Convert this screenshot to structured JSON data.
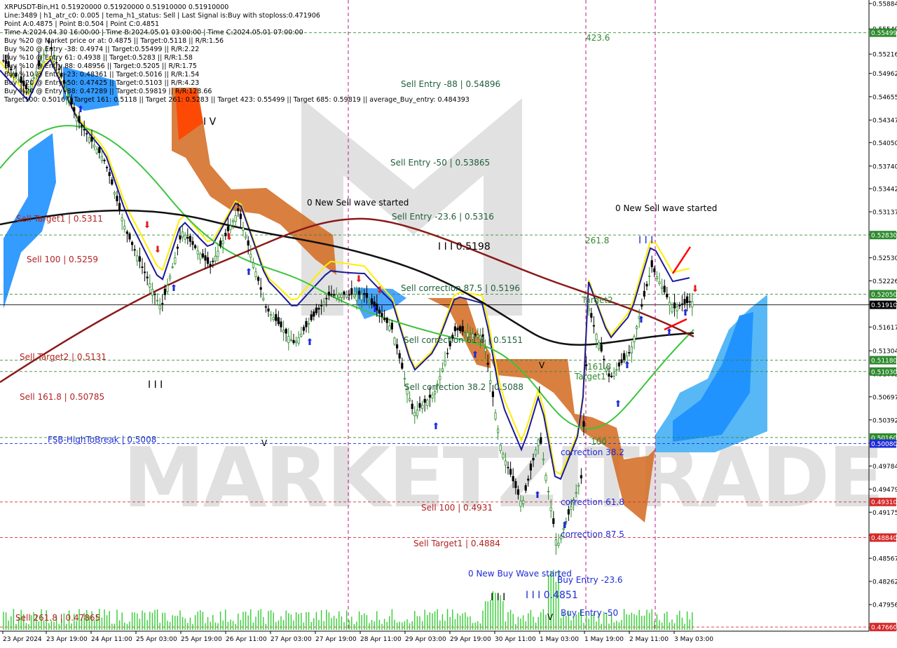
{
  "chart_data": {
    "type": "candlestick",
    "symbol": "XRPUSDT-Bin,H1",
    "ohlc": "0.51920000 0.51920000 0.51910000 0.51910000",
    "current_price": "0.51910",
    "watermark": "MARKETZITRADE",
    "info_lines": [
      "XRPUSDT-Bin,H1  0.51920000 0.51920000 0.51910000 0.51910000",
      "Line:3489  |  h1_atr_c0: 0.005  |  tema_h1_status: Sell  |  Last Signal is:Buy with stoploss:0.471906",
      "Point A:0.4875  |  Point B:0.504  |  Point C:0.4851",
      "Time A:2024.04.30 16:00:00  |  Time B:2024.05.01 03:00:00  |  Time C:2024.05.01 07:00:00",
      "Buy %20 @ Market price or at: 0.4875  ||  Target:0.5118  ||  R/R:1.56",
      "Buy %20 @ Entry -38: 0.4974  ||  Target:0.55499  ||  R/R:2.22",
      "Buy %10 @ Entry 61: 0.4938  ||  Target:0.5283  ||  R/R:1.58",
      "Buy %10 @ Entry 88: 0.48956  ||  Target:0.5205  ||  R/R:1.75",
      "Buy %10 @ Entry -23: 0.48361  ||  Target:0.5016  ||  R/R:1.54",
      "Buy %20 @ Entry -50: 0.47425  ||  Target:0.5103  ||  R/R:4.23",
      "Buy %20 @ Entry -88: 0.47289  ||  Target:0.59819  ||  R/R:128.66",
      "Target100: 0.5016  ||  Target 161: 0.5118  ||  Target 261: 0.5283  ||  Target 423: 0.55499  ||  Target 685: 0.59819  ||  average_Buy_entry: 0.484393"
    ],
    "price_ticks": [
      "0.55884",
      "0.55549",
      "0.55216",
      "0.54962",
      "0.54655",
      "0.54347",
      "0.54050",
      "0.53740",
      "0.53442",
      "0.53137",
      "0.52836",
      "0.52530",
      "0.52226",
      "0.51917",
      "0.51617",
      "0.51304",
      "0.51002",
      "0.50697",
      "0.50392",
      "0.50087",
      "0.49784",
      "0.49479",
      "0.49175",
      "0.48870",
      "0.48567",
      "0.48262",
      "0.47956",
      "0.47652"
    ],
    "time_ticks": [
      "23 Apr 2024",
      "23 Apr 19:00",
      "24 Apr 11:00",
      "25 Apr 03:00",
      "25 Apr 19:00",
      "26 Apr 11:00",
      "27 Apr 03:00",
      "27 Apr 19:00",
      "28 Apr 11:00",
      "29 Apr 03:00",
      "29 Apr 19:00",
      "30 Apr 11:00",
      "1 May 03:00",
      "1 May 19:00",
      "2 May 11:00",
      "3 May 03:00"
    ],
    "price_tags": [
      {
        "value": "0.55499",
        "price": 0.55499,
        "color": "#2e8b2e"
      },
      {
        "value": "0.52830",
        "price": 0.5283,
        "color": "#2e8b2e"
      },
      {
        "value": "0.52050",
        "price": 0.5205,
        "color": "#2e8b2e"
      },
      {
        "value": "0.51910",
        "price": 0.5191,
        "color": "#000000"
      },
      {
        "value": "0.51180",
        "price": 0.5118,
        "color": "#2e8b2e"
      },
      {
        "value": "0.51030",
        "price": 0.5103,
        "color": "#2e8b2e"
      },
      {
        "value": "0.50160",
        "price": 0.5016,
        "color": "#2e8b2e"
      },
      {
        "value": "0.50080",
        "price": 0.5008,
        "color": "#1e2bd6"
      },
      {
        "value": "0.49310",
        "price": 0.4931,
        "color": "#d62a2a"
      },
      {
        "value": "0.48840",
        "price": 0.4884,
        "color": "#d62a2a"
      },
      {
        "value": "0.47660",
        "price": 0.4766,
        "color": "#d62a2a"
      }
    ],
    "labels": [
      {
        "text": "423.6",
        "color": "#2e8b2e"
      },
      {
        "text": "Sell Entry -88 | 0.54896",
        "color": "#1f5e3a"
      },
      {
        "text": "Sell Entry -50 | 0.53865",
        "color": "#1f5e3a"
      },
      {
        "text": "0 New Sell wave started",
        "color": "#000000"
      },
      {
        "text": "Sell Entry -23.6 | 0.5316",
        "color": "#1f5e3a"
      },
      {
        "text": "0 New Sell wave started",
        "color": "#000000"
      },
      {
        "text": "Sell Target1 | 0.5311",
        "color": "#b22222"
      },
      {
        "text": "Sell 100 | 0.5259",
        "color": "#b22222"
      },
      {
        "text": "261.8",
        "color": "#2e8b2e"
      },
      {
        "text": "I I I 0.5198",
        "color": "#000000"
      },
      {
        "text": "Sell correction 87.5 | 0.5196",
        "color": "#1f5e3a"
      },
      {
        "text": "Target2",
        "color": "#2e8b2e"
      },
      {
        "text": "Sell correction 61.8 | 0.5151",
        "color": "#1f5e3a"
      },
      {
        "text": "Sell Target2 | 0.5131",
        "color": "#b22222"
      },
      {
        "text": "161.8",
        "color": "#2e8b2e"
      },
      {
        "text": "Target1",
        "color": "#2e8b2e"
      },
      {
        "text": "Sell correction 38.2 | 0.5088",
        "color": "#1f5e3a"
      },
      {
        "text": "Sell 161.8 | 0.50785",
        "color": "#b22222"
      },
      {
        "text": "FSB-HighToBreak | 0.5008",
        "color": "#1e2bd6"
      },
      {
        "text": "100",
        "color": "#2e8b2e"
      },
      {
        "text": "correction 38.2",
        "color": "#1e2bd6"
      },
      {
        "text": "correction 61.8",
        "color": "#1e2bd6"
      },
      {
        "text": "Sell 100 | 0.4931",
        "color": "#b22222"
      },
      {
        "text": "correction 87.5",
        "color": "#1e2bd6"
      },
      {
        "text": "Sell Target1 | 0.4884",
        "color": "#b22222"
      },
      {
        "text": "0 New Buy Wave started",
        "color": "#1e2bd6"
      },
      {
        "text": "Buy Entry -23.6",
        "color": "#1e2bd6"
      },
      {
        "text": "I I I 0.4851",
        "color": "#1e2bd6"
      },
      {
        "text": "Buy Entry -50",
        "color": "#1e2bd6"
      },
      {
        "text": "Sell 261.8 | 0.47865",
        "color": "#b22222"
      },
      {
        "text": "I V",
        "color": "#000000"
      },
      {
        "text": "I I I",
        "color": "#000000"
      },
      {
        "text": "V",
        "color": "#000000"
      },
      {
        "text": "V",
        "color": "#000000"
      },
      {
        "text": "I I I",
        "color": "#1e2bd6"
      },
      {
        "text": "I",
        "color": "#000000"
      },
      {
        "text": "I I I",
        "color": "#000000"
      },
      {
        "text": "V",
        "color": "#000000"
      }
    ],
    "colors": {
      "up": "#2e8b2e",
      "down": "#000000",
      "ma_maroon": "#8b1a1a",
      "ma_black": "#111111",
      "ma_green": "#3cc43c",
      "ma_blue": "#1a1a9a",
      "ma_yellow": "#ffee00",
      "cloud_orange": "#d2691e",
      "cloud_blue": "#1e90ff"
    }
  }
}
